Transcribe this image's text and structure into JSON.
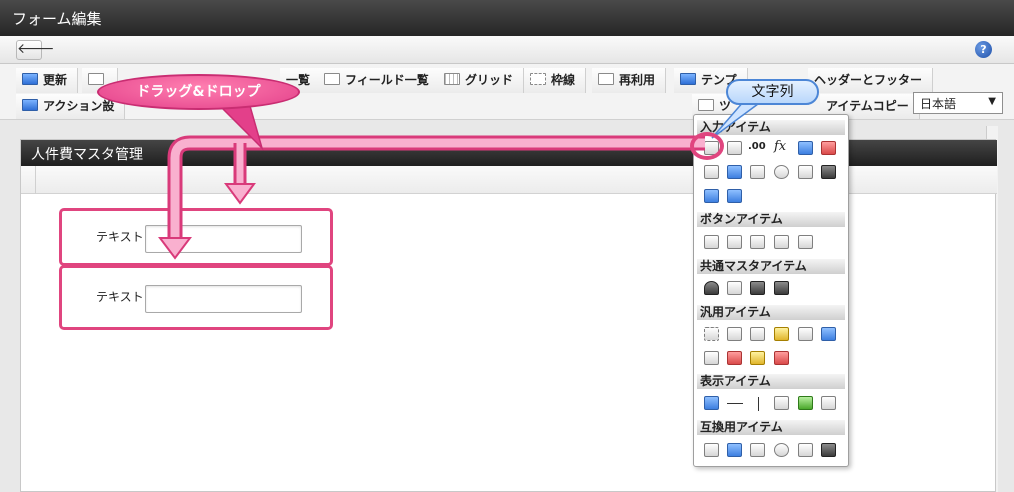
{
  "window": {
    "title": "フォーム編集",
    "back": "🡐",
    "help": "?"
  },
  "toolbar": {
    "update": "更新",
    "field_list_partial": "一覧",
    "field_list": "フィールド一覧",
    "grid": "グリッド",
    "frame_line": "枠線",
    "reuse": "再利用",
    "template_partial": "テンプ",
    "header_footer": "ヘッダーとフッター",
    "action_partial": "アクション設",
    "tool_partial": "ツ",
    "item_copy": "アイテムコピー",
    "language": "日本語"
  },
  "form": {
    "title": "人件費マスタ管理",
    "rows": [
      {
        "label": "テキスト",
        "value": ""
      },
      {
        "label": "テキスト",
        "value": ""
      }
    ]
  },
  "palette": {
    "sections": {
      "input": "入力アイテム",
      "button": "ボタンアイテム",
      "common_master": "共通マスタアイテム",
      "general": "汎用アイテム",
      "display": "表示アイテム",
      "compat": "互換用アイテム"
    },
    "fx": "fx",
    "num": ".00"
  },
  "annotations": {
    "drag_drop": "ドラッグ&ドロップ",
    "string": "文字列"
  },
  "colors": {
    "accent_pink": "#e0457f",
    "callout_blue": "#4c86d6"
  }
}
